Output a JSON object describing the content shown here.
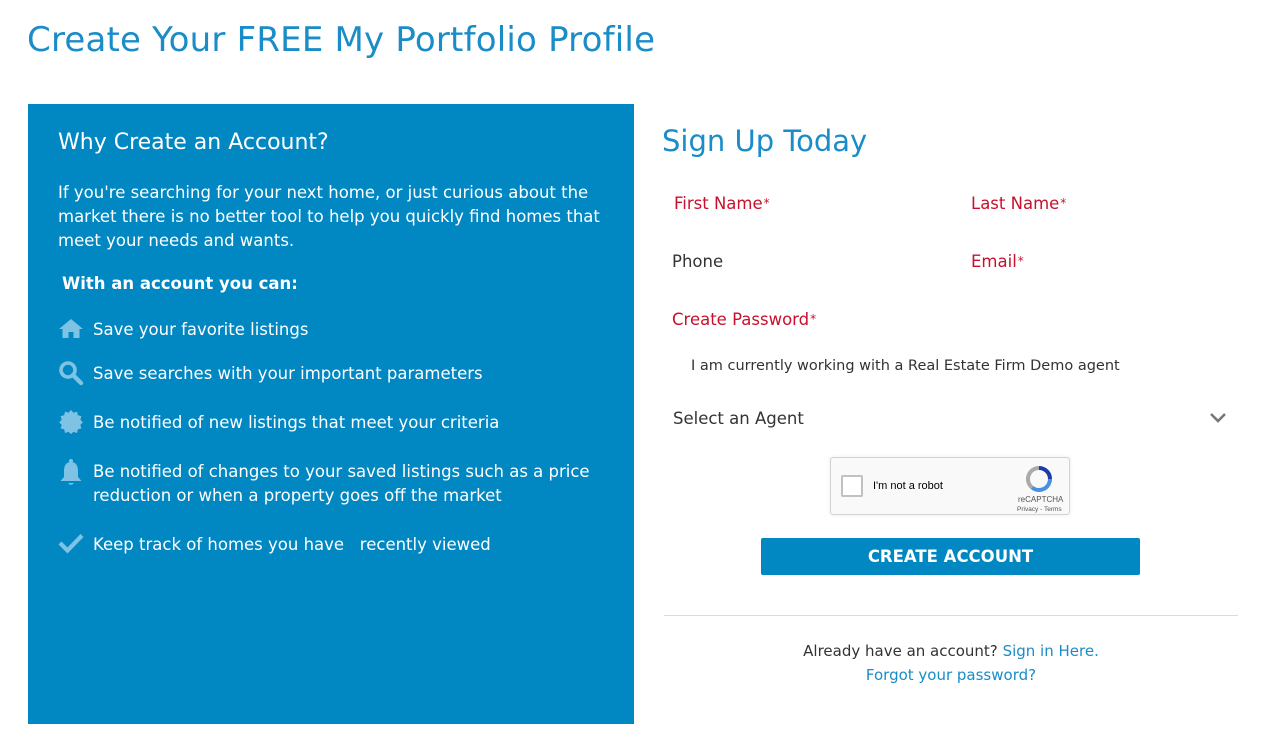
{
  "page": {
    "title": "Create Your FREE My Portfolio Profile"
  },
  "why": {
    "title": "Why Create an Account?",
    "intro": "If you're searching for your next home, or just curious about the market there is no better tool to help you quickly find homes that meet your needs and wants.",
    "subhead": "With an account you can:",
    "benefits": [
      {
        "icon": "home-icon",
        "text": "Save your favorite listings"
      },
      {
        "icon": "search-icon",
        "text": "Save searches with your important parameters"
      },
      {
        "icon": "badge-icon",
        "text": "Be notified of new listings that meet your criteria"
      },
      {
        "icon": "bell-icon",
        "text": "Be notified of changes to your saved listings such as a price reduction or when a property goes off the market"
      },
      {
        "icon": "checkmark-icon",
        "text": "Keep track of homes you have   recently viewed"
      }
    ]
  },
  "form": {
    "title": "Sign Up Today",
    "first_name": "First Name",
    "last_name": "Last Name",
    "phone": "Phone",
    "email": "Email",
    "password": "Create Password",
    "required_mark": "*",
    "agent_checkbox_label": "I am currently working with a Real Estate Firm Demo agent",
    "agent_select_placeholder": "Select an Agent",
    "captcha_label": "I'm not a robot",
    "captcha_brand": "reCAPTCHA",
    "captcha_terms": "Privacy - Terms",
    "submit_label": "CREATE ACCOUNT",
    "signin_prompt": "Already have an account?",
    "signin_link": "Sign in Here.",
    "forgot_link": "Forgot your password?"
  },
  "colors": {
    "accent": "#1a8cc8",
    "panel": "#0187c2",
    "required": "#c8102e",
    "icon": "#7fc3e4"
  }
}
